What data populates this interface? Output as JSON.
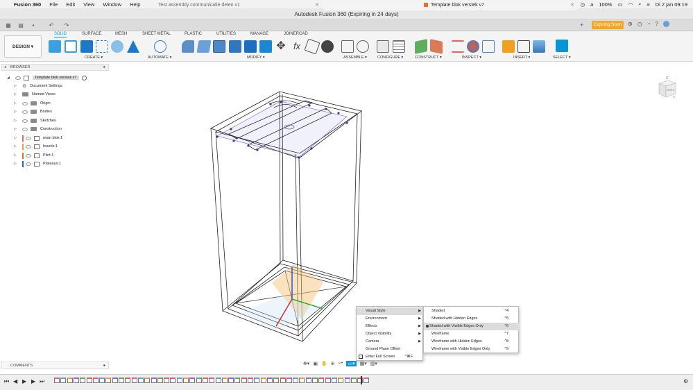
{
  "menubar": {
    "app_name": "Fusion 360",
    "items": [
      "File",
      "Edit",
      "View",
      "Window",
      "Help"
    ],
    "battery": "100%",
    "clock": "Di 2 jan  09:19"
  },
  "window": {
    "title": "Autodesk Fusion 360 (Expiring in 24 days)"
  },
  "doc_tabs": [
    {
      "label": "Test assembly communicatie delen v1"
    },
    {
      "label": "Template blok verstek v7"
    }
  ],
  "expiring_label": "Expiring Soon",
  "workspace": {
    "label": "DESIGN ▾"
  },
  "ribbon_tabs": [
    "SOLID",
    "SURFACE",
    "MESH",
    "SHEET METAL",
    "PLASTIC",
    "UTILITIES",
    "MANAGE",
    "JOINERCAD"
  ],
  "ribbon_groups": [
    "CREATE ▾",
    "AUTOMATE ▾",
    "MODIFY ▾",
    "ASSEMBLE ▾",
    "CONFIGURE ▾",
    "CONSTRUCT ▾",
    "INSPECT ▾",
    "INSERT ▾",
    "SELECT ▾"
  ],
  "browser": {
    "header": "BROWSER",
    "root": "Template blok verstek v7",
    "items": [
      {
        "label": "Document Settings"
      },
      {
        "label": "Named Views"
      },
      {
        "label": "Origin"
      },
      {
        "label": "Bodies"
      },
      {
        "label": "Sketches"
      },
      {
        "label": "Construction"
      },
      {
        "label": "main blok:1",
        "color": "#e06c6c"
      },
      {
        "label": "Inserts:1",
        "color": "#e8a040"
      },
      {
        "label": "Plint:1",
        "color": "#e07030"
      },
      {
        "label": "Plateaus:1",
        "color": "#3060c0"
      }
    ]
  },
  "comments_label": "COMMENTS",
  "context_menu": {
    "items": [
      {
        "label": "Visual Style"
      },
      {
        "label": "Environment"
      },
      {
        "label": "Effects"
      },
      {
        "label": "Object Visibility"
      },
      {
        "label": "Camera"
      },
      {
        "label": "Ground Plane Offset"
      },
      {
        "label": "Enter Full Screen",
        "shortcut": "^⌘F"
      }
    ]
  },
  "visual_style_menu": {
    "items": [
      {
        "label": "Shaded",
        "shortcut": "^4"
      },
      {
        "label": "Shaded with Hidden Edges",
        "shortcut": "^5"
      },
      {
        "label": "Shaded with Visible Edges Only",
        "shortcut": "^6"
      },
      {
        "label": "Wireframe",
        "shortcut": "^7"
      },
      {
        "label": "Wireframe with Hidden Edges",
        "shortcut": "^8"
      },
      {
        "label": "Wireframe with Visible Edges Only",
        "shortcut": "^9"
      }
    ]
  },
  "viewcube": {
    "face_label": "RIGHT",
    "axis_z": "Z",
    "axis_x": "X"
  },
  "colors": {
    "accent": "#0696d7",
    "expiring": "#f5a623",
    "sketch": "#6a5acd"
  }
}
